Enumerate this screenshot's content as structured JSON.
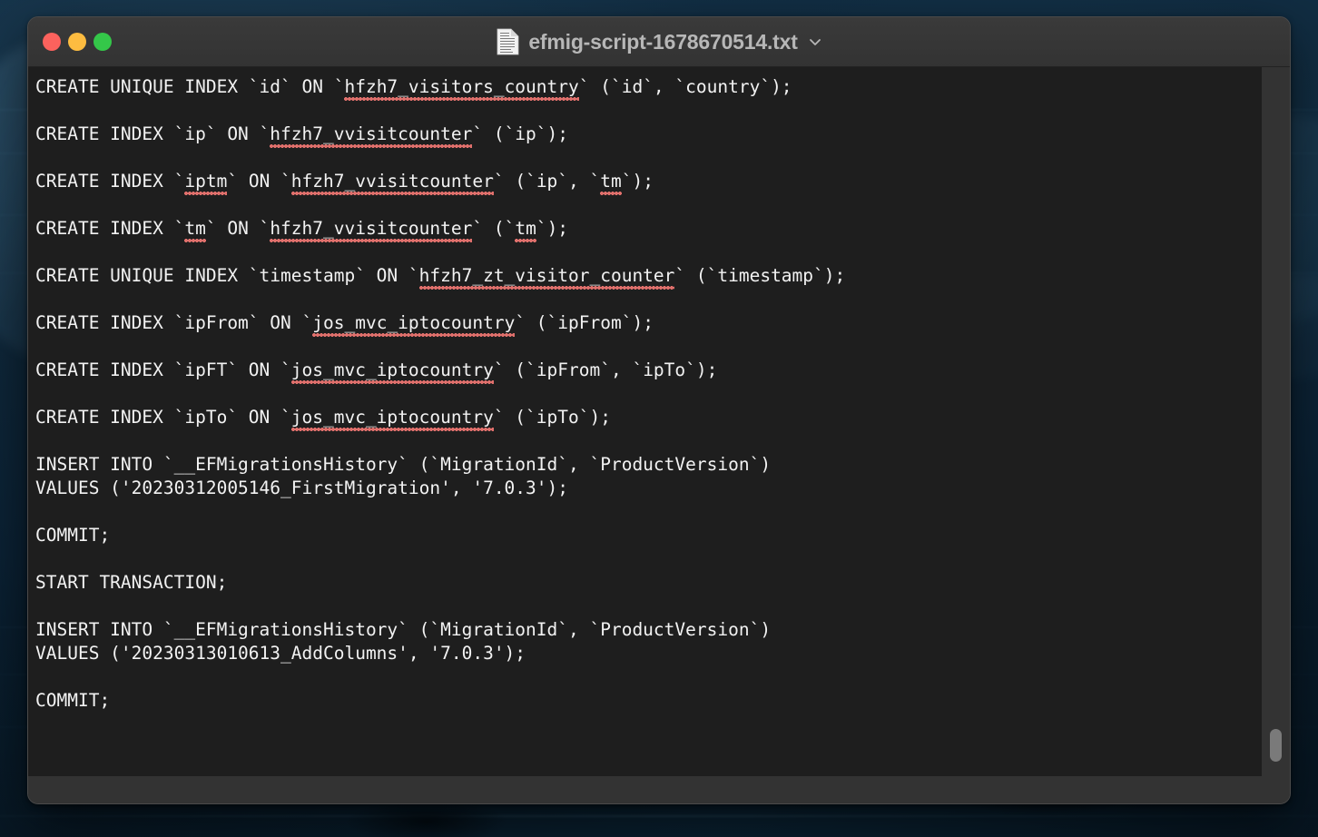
{
  "window": {
    "title": "efmig-script-1678670514.txt",
    "title_icon": "text-document-icon",
    "title_chevron": "chevron-down-icon",
    "traffic_lights": [
      {
        "name": "close",
        "color": "#fc625d"
      },
      {
        "name": "minimize",
        "color": "#fdbc40"
      },
      {
        "name": "maximize",
        "color": "#34c749"
      }
    ],
    "background_color": "#333333",
    "text_background_color": "#1e1e1e",
    "text_color": "#f2f2f2",
    "spellcheck_underline_color": "#e0706c"
  },
  "document": {
    "lines": [
      {
        "text": "CREATE UNIQUE INDEX `id` ON `hfzh7_visitors_country` (`id`, `country`);",
        "misspelled": [
          "hfzh7_visitors_country"
        ]
      },
      {
        "text": "",
        "misspelled": []
      },
      {
        "text": "CREATE INDEX `ip` ON `hfzh7_vvisitcounter` (`ip`);",
        "misspelled": [
          "hfzh7_vvisitcounter"
        ]
      },
      {
        "text": "",
        "misspelled": []
      },
      {
        "text": "CREATE INDEX `iptm` ON `hfzh7_vvisitcounter` (`ip`, `tm`);",
        "misspelled": [
          "iptm",
          "hfzh7_vvisitcounter",
          "tm"
        ]
      },
      {
        "text": "",
        "misspelled": []
      },
      {
        "text": "CREATE INDEX `tm` ON `hfzh7_vvisitcounter` (`tm`);",
        "misspelled": [
          "tm",
          "hfzh7_vvisitcounter",
          "tm"
        ]
      },
      {
        "text": "",
        "misspelled": []
      },
      {
        "text": "CREATE UNIQUE INDEX `timestamp` ON `hfzh7_zt_visitor_counter` (`timestamp`);",
        "misspelled": [
          "hfzh7_zt_visitor_counter"
        ]
      },
      {
        "text": "",
        "misspelled": []
      },
      {
        "text": "CREATE INDEX `ipFrom` ON `jos_mvc_iptocountry` (`ipFrom`);",
        "misspelled": [
          "jos_mvc_iptocountry"
        ]
      },
      {
        "text": "",
        "misspelled": []
      },
      {
        "text": "CREATE INDEX `ipFT` ON `jos_mvc_iptocountry` (`ipFrom`, `ipTo`);",
        "misspelled": [
          "jos_mvc_iptocountry"
        ]
      },
      {
        "text": "",
        "misspelled": []
      },
      {
        "text": "CREATE INDEX `ipTo` ON `jos_mvc_iptocountry` (`ipTo`);",
        "misspelled": [
          "jos_mvc_iptocountry"
        ]
      },
      {
        "text": "",
        "misspelled": []
      },
      {
        "text": "INSERT INTO `__EFMigrationsHistory` (`MigrationId`, `ProductVersion`)",
        "misspelled": []
      },
      {
        "text": "VALUES ('20230312005146_FirstMigration', '7.0.3');",
        "misspelled": []
      },
      {
        "text": "",
        "misspelled": []
      },
      {
        "text": "COMMIT;",
        "misspelled": []
      },
      {
        "text": "",
        "misspelled": []
      },
      {
        "text": "START TRANSACTION;",
        "misspelled": []
      },
      {
        "text": "",
        "misspelled": []
      },
      {
        "text": "INSERT INTO `__EFMigrationsHistory` (`MigrationId`, `ProductVersion`)",
        "misspelled": []
      },
      {
        "text": "VALUES ('20230313010613_AddColumns', '7.0.3');",
        "misspelled": []
      },
      {
        "text": "",
        "misspelled": []
      },
      {
        "text": "COMMIT;",
        "misspelled": []
      }
    ]
  },
  "scrollbar": {
    "orientation": "vertical",
    "thumb_position": "bottom"
  }
}
